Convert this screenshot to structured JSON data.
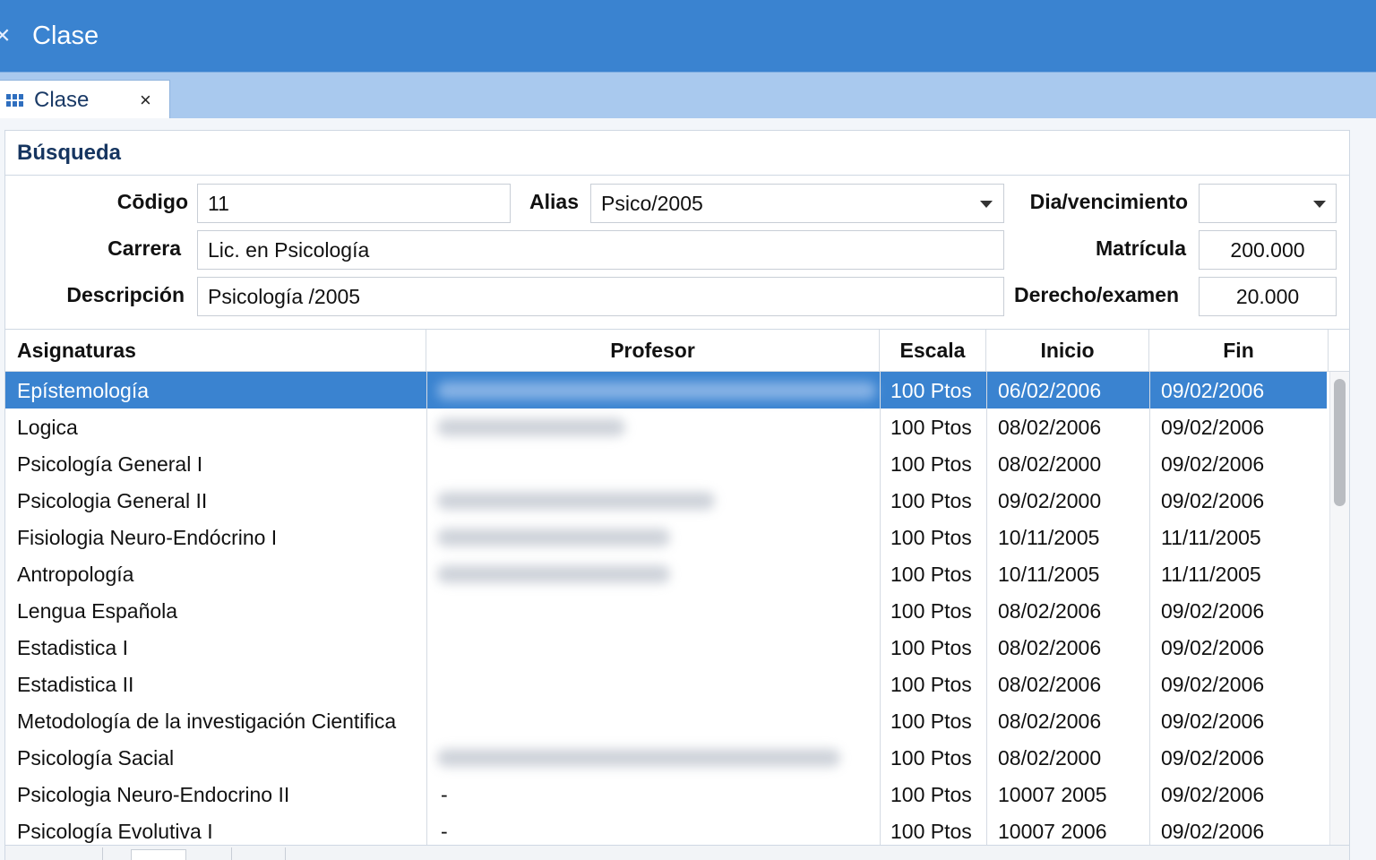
{
  "window": {
    "title": "Clase",
    "close_glyph": "×"
  },
  "tab": {
    "label": "Clase",
    "close_glyph": "×",
    "icon": "grid-icon"
  },
  "section": {
    "title": "Búsqueda"
  },
  "form": {
    "codigo_label": "Cōdigo",
    "codigo_value": "11",
    "alias_label": "Alias",
    "alias_value": "Psico/2005",
    "dia_label": "Dia/vencimiento",
    "dia_value": "",
    "carrera_label": "Carrera",
    "carrera_value": "Lic. en Psicología",
    "matricula_label": "Matrícula",
    "matricula_value": "200.000",
    "descripcion_label": "Descripción",
    "descripcion_value": "Psicología /2005",
    "derecho_label": "Derecho/examen",
    "derecho_value": "20.000"
  },
  "table": {
    "headers": {
      "asignaturas": "Asignaturas",
      "profesor": "Profesor",
      "escala": "Escala",
      "inicio": "Inicio",
      "fin": "Fin"
    },
    "rows": [
      {
        "asignatura": "Epístemología",
        "profesor": "",
        "escala": "100 Ptos",
        "inicio": "06/02/2006",
        "fin": "09/02/2006"
      },
      {
        "asignatura": "Logica",
        "profesor": "",
        "escala": "100 Ptos",
        "inicio": "08/02/2006",
        "fin": "09/02/2006"
      },
      {
        "asignatura": "Psicología General I",
        "profesor": "",
        "escala": "100 Ptos",
        "inicio": "08/02/2000",
        "fin": "09/02/2006"
      },
      {
        "asignatura": "Psicologia General II",
        "profesor": "",
        "escala": "100 Ptos",
        "inicio": "09/02/2000",
        "fin": "09/02/2006"
      },
      {
        "asignatura": "Fisiologia Neuro-Endócrino I",
        "profesor": "",
        "escala": "100 Ptos",
        "inicio": "10/11/2005",
        "fin": "11/11/2005"
      },
      {
        "asignatura": "Antropología",
        "profesor": "",
        "escala": "100 Ptos",
        "inicio": "10/11/2005",
        "fin": "11/11/2005"
      },
      {
        "asignatura": "Lengua Española",
        "profesor": "",
        "escala": "100 Ptos",
        "inicio": "08/02/2006",
        "fin": "09/02/2006"
      },
      {
        "asignatura": "Estadistica I",
        "profesor": "",
        "escala": "100 Ptos",
        "inicio": "08/02/2006",
        "fin": "09/02/2006"
      },
      {
        "asignatura": "Estadistica II",
        "profesor": "",
        "escala": "100 Ptos",
        "inicio": "08/02/2006",
        "fin": "09/02/2006"
      },
      {
        "asignatura": "Metodología de la investigación Cientifica",
        "profesor": "",
        "escala": "100 Ptos",
        "inicio": "08/02/2006",
        "fin": "09/02/2006"
      },
      {
        "asignatura": "Psicología Sacial",
        "profesor": "",
        "escala": "100 Ptos",
        "inicio": "08/02/2000",
        "fin": "09/02/2006"
      },
      {
        "asignatura": "Psicologia Neuro-Endocrino II",
        "profesor": "-",
        "escala": "100 Ptos",
        "inicio": "10007 2005",
        "fin": "09/02/2006"
      },
      {
        "asignatura": "Psicología Evolutiva I",
        "profesor": "-",
        "escala": "100 Ptos",
        "inicio": "10007 2006",
        "fin": "09/02/2006"
      }
    ],
    "selected_row": 0
  },
  "colors": {
    "accent": "#3a83d0",
    "tabstrip": "#a9c9ee",
    "header_text": "#163560"
  }
}
